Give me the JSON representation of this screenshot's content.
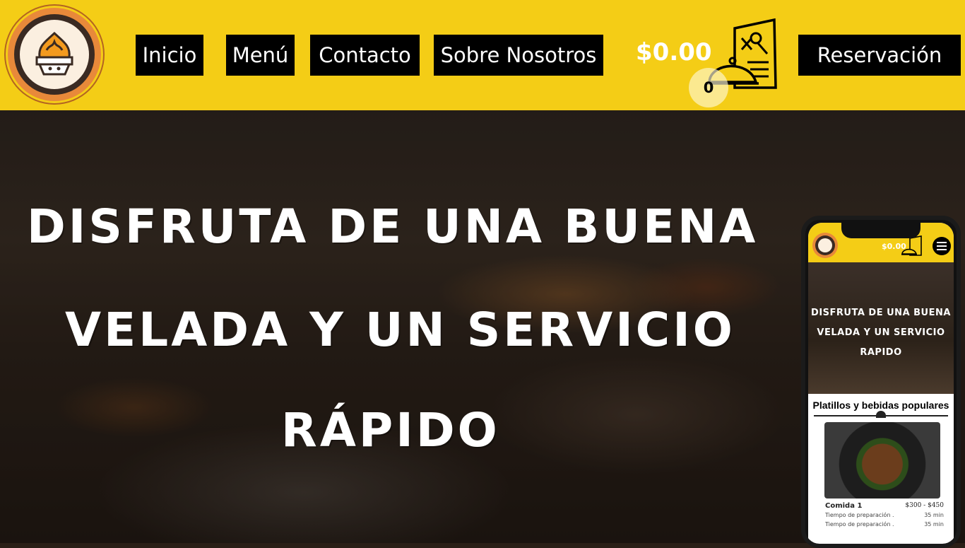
{
  "header": {
    "nav": [
      "Inicio",
      "Menú",
      "Contacto",
      "Sobre Nosotros"
    ],
    "cart_total": "$0.00",
    "cart_count": "0",
    "reserve_label": "Reservación",
    "colors": {
      "accent": "#f4cd16",
      "button": "#000000"
    },
    "icons": [
      "restaurant-logo",
      "menu-cart-icon"
    ]
  },
  "hero": {
    "lines": [
      "DISFRUTA DE UNA BUENA",
      "VELADA Y UN SERVICIO",
      "RÁPIDO"
    ]
  },
  "mobile_preview": {
    "cart_total": "$0.00",
    "hero_lines": [
      "DISFRUTA DE UNA BUENA",
      "VELADA Y UN SERVICIO",
      "RAPIDO"
    ],
    "section_title": "Platillos y bebidas populares",
    "item": {
      "name": "Comida 1",
      "price": "$300 - $450",
      "rows": [
        {
          "label": "Tiempo de preparación .",
          "value": "35 min"
        },
        {
          "label": "Tiempo de preparación .",
          "value": "35 min"
        }
      ]
    }
  }
}
